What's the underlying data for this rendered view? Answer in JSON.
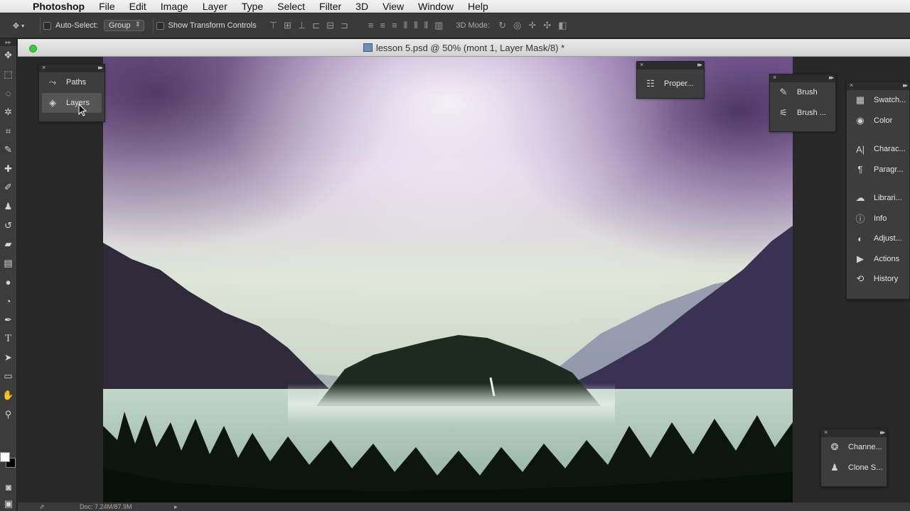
{
  "menubar": {
    "apple_icon": "apple-logo-icon",
    "app_name": "Photoshop",
    "items": [
      "File",
      "Edit",
      "Image",
      "Layer",
      "Type",
      "Select",
      "Filter",
      "3D",
      "View",
      "Window",
      "Help"
    ]
  },
  "options": {
    "auto_select_label": "Auto-Select:",
    "auto_select_value": "Group",
    "transform_label": "Show Transform Controls",
    "mode_3d_label": "3D Mode:"
  },
  "document": {
    "title": "lesson 5.psd @ 50% (mont 1, Layer Mask/8) *",
    "status": "Doc: 7.24M/87.9M"
  },
  "panels": {
    "left": [
      {
        "label": "Paths",
        "icon": "paths-icon"
      },
      {
        "label": "Layers",
        "icon": "layers-icon"
      }
    ],
    "properties": {
      "label": "Proper...",
      "icon": "properties-icon"
    },
    "brush": [
      {
        "label": "Brush",
        "icon": "brush-icon"
      },
      {
        "label": "Brush ...",
        "icon": "brush-presets-icon"
      }
    ],
    "right": [
      {
        "label": "Swatch...",
        "icon": "swatches-icon"
      },
      {
        "label": "Color",
        "icon": "color-icon"
      },
      {
        "label": "Charac...",
        "icon": "character-icon"
      },
      {
        "label": "Paragr...",
        "icon": "paragraph-icon"
      },
      {
        "label": "Librari...",
        "icon": "libraries-icon"
      },
      {
        "label": "Info",
        "icon": "info-icon"
      },
      {
        "label": "Adjust...",
        "icon": "adjustments-icon"
      },
      {
        "label": "Actions",
        "icon": "actions-icon"
      },
      {
        "label": "History",
        "icon": "history-icon"
      }
    ],
    "bottom": [
      {
        "label": "Channe...",
        "icon": "channels-icon"
      },
      {
        "label": "Clone S...",
        "icon": "clone-source-icon"
      }
    ]
  },
  "colors": {
    "foreground": "#ffffff",
    "background": "#000000",
    "panel_bg": "#3d3d3d",
    "app_bg": "#282828"
  }
}
